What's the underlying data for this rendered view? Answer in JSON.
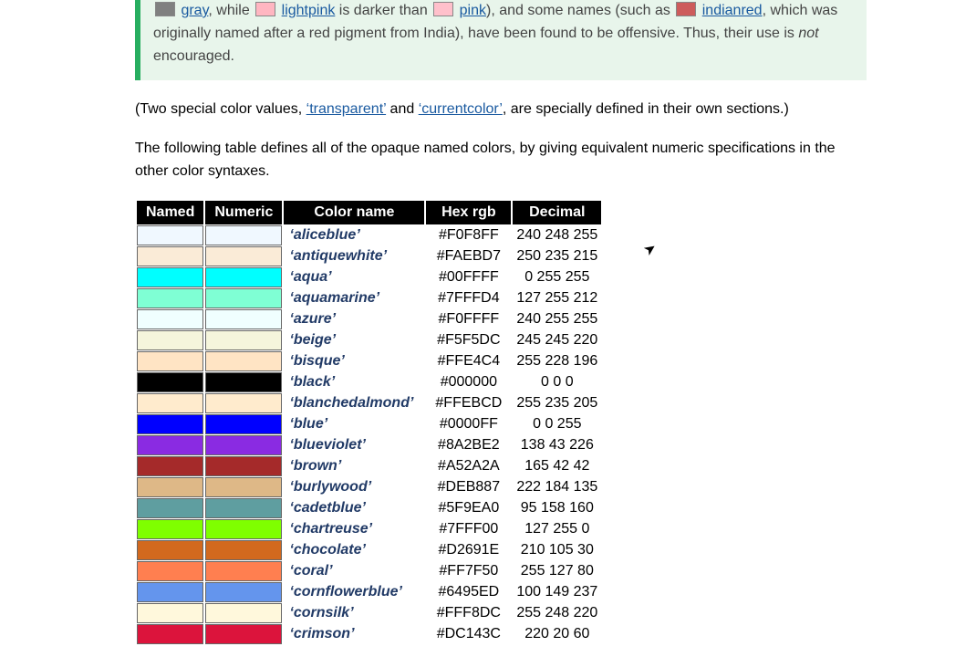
{
  "note": {
    "gray_link": "gray",
    "while_txt": ", while ",
    "lightpink_link": "lightpink",
    "is_darker": " is darker than ",
    "pink_link": "pink",
    "after_pink": "), and some names (such as ",
    "indianred_link": "indianred",
    "after_indianred": ", which was originally named after a red pigment from India), have been found to be offensive. Thus, their use is ",
    "not_word": "not",
    "encouraged": " encouraged.",
    "swatches": {
      "gray": "#808080",
      "lightpink": "#FFB6C1",
      "pink": "#FFC0CB",
      "indianred": "#CD5C5C"
    }
  },
  "para1": {
    "pre": "(Two special color values, ",
    "link1": "‘transparent’",
    "mid": " and ",
    "link2": "‘currentcolor’",
    "post": ", are specially defined in their own sections.)"
  },
  "para2": "The following table defines all of the opaque named colors, by giving equivalent numeric specifications in the other color syntaxes.",
  "table": {
    "headers": {
      "named": "Named",
      "numeric": "Numeric",
      "colorname": "Color name",
      "hex": "Hex rgb",
      "decimal": "Decimal"
    },
    "rows": [
      {
        "name": "aliceblue",
        "hex": "#F0F8FF",
        "dec": "240 248 255",
        "rgb": "#F0F8FF"
      },
      {
        "name": "antiquewhite",
        "hex": "#FAEBD7",
        "dec": "250 235 215",
        "rgb": "#FAEBD7"
      },
      {
        "name": "aqua",
        "hex": "#00FFFF",
        "dec": "0 255 255",
        "rgb": "#00FFFF"
      },
      {
        "name": "aquamarine",
        "hex": "#7FFFD4",
        "dec": "127 255 212",
        "rgb": "#7FFFD4"
      },
      {
        "name": "azure",
        "hex": "#F0FFFF",
        "dec": "240 255 255",
        "rgb": "#F0FFFF"
      },
      {
        "name": "beige",
        "hex": "#F5F5DC",
        "dec": "245 245 220",
        "rgb": "#F5F5DC"
      },
      {
        "name": "bisque",
        "hex": "#FFE4C4",
        "dec": "255 228 196",
        "rgb": "#FFE4C4"
      },
      {
        "name": "black",
        "hex": "#000000",
        "dec": "0 0 0",
        "rgb": "#000000"
      },
      {
        "name": "blanchedalmond",
        "hex": "#FFEBCD",
        "dec": "255 235 205",
        "rgb": "#FFEBCD"
      },
      {
        "name": "blue",
        "hex": "#0000FF",
        "dec": "0 0 255",
        "rgb": "#0000FF"
      },
      {
        "name": "blueviolet",
        "hex": "#8A2BE2",
        "dec": "138 43 226",
        "rgb": "#8A2BE2"
      },
      {
        "name": "brown",
        "hex": "#A52A2A",
        "dec": "165 42 42",
        "rgb": "#A52A2A"
      },
      {
        "name": "burlywood",
        "hex": "#DEB887",
        "dec": "222 184 135",
        "rgb": "#DEB887"
      },
      {
        "name": "cadetblue",
        "hex": "#5F9EA0",
        "dec": "95 158 160",
        "rgb": "#5F9EA0"
      },
      {
        "name": "chartreuse",
        "hex": "#7FFF00",
        "dec": "127 255 0",
        "rgb": "#7FFF00"
      },
      {
        "name": "chocolate",
        "hex": "#D2691E",
        "dec": "210 105 30",
        "rgb": "#D2691E"
      },
      {
        "name": "coral",
        "hex": "#FF7F50",
        "dec": "255 127 80",
        "rgb": "#FF7F50"
      },
      {
        "name": "cornflowerblue",
        "hex": "#6495ED",
        "dec": "100 149 237",
        "rgb": "#6495ED"
      },
      {
        "name": "cornsilk",
        "hex": "#FFF8DC",
        "dec": "255 248 220",
        "rgb": "#FFF8DC"
      },
      {
        "name": "crimson",
        "hex": "#DC143C",
        "dec": "220 20 60",
        "rgb": "#DC143C"
      }
    ]
  }
}
